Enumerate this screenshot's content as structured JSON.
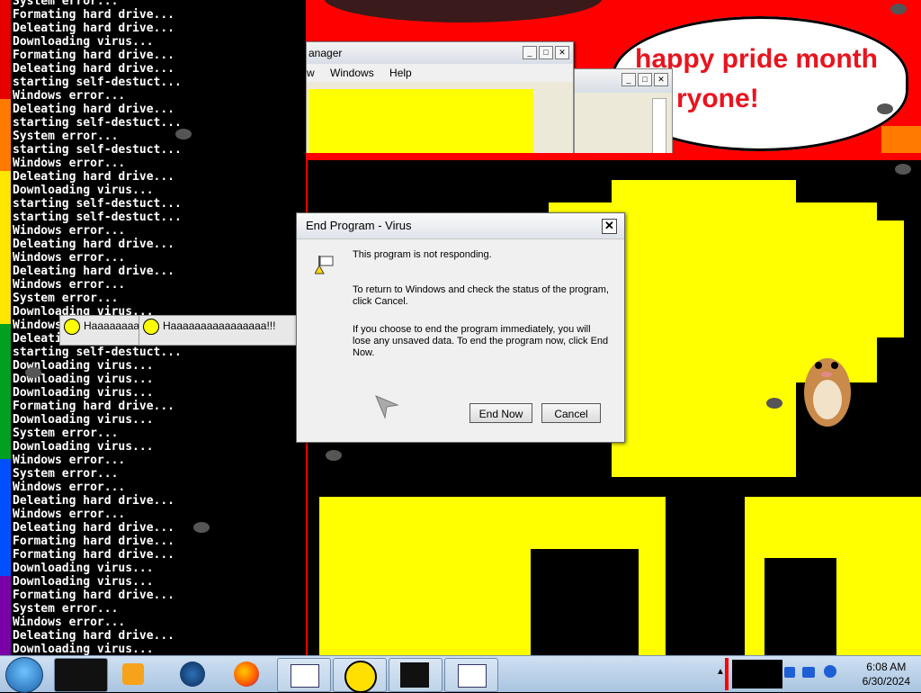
{
  "terminal": {
    "lines": [
      "System error...",
      "Formating hard drive...",
      "Deleating hard drive...",
      "Downloading virus...",
      "Formating hard drive...",
      "Deleating hard drive...",
      "starting self-destuct...",
      "Windows error...",
      "Deleating hard drive...",
      "starting self-destuct...",
      "System error...",
      "starting self-destuct...",
      "Windows error...",
      "Deleating hard drive...",
      "Downloading virus...",
      "starting self-destuct...",
      "starting self-destuct...",
      "Windows error...",
      "Deleating hard drive...",
      "Windows error...",
      "Deleating hard drive...",
      "Windows error...",
      "System error...",
      "Downloading virus...",
      "Windows error...",
      "Deleating hard drive...",
      "starting self-destuct...",
      "Downloading virus...",
      "Downloading virus...",
      "Downloading virus...",
      "Formating hard drive...",
      "Downloading virus...",
      "System error...",
      "Downloading virus...",
      "Windows error...",
      "System error...",
      "Windows error...",
      "Deleating hard drive...",
      "Windows error...",
      "Deleating hard drive...",
      "Formating hard drive...",
      "Formating hard drive...",
      "Downloading virus...",
      "Downloading virus...",
      "Formating hard drive...",
      "System error...",
      "Windows error...",
      "Deleating hard drive...",
      "Downloading virus..."
    ]
  },
  "task_manager": {
    "title": "anager",
    "menu": [
      "w",
      "Windows",
      "Help"
    ]
  },
  "bubble": {
    "line1": "happy pride month",
    "line2": "ryone!"
  },
  "haa_windows": [
    {
      "label": "Haaaaaaaaaa"
    },
    {
      "label": "Haaaaaaaaaaaaaaaa!!!"
    }
  ],
  "dialog": {
    "title": "End Program - Virus",
    "close": "✕",
    "line1": "This program is not responding.",
    "line2": "To return to Windows and check the status of the program, click Cancel.",
    "line3": "If you choose to end the program immediately, you will lose any unsaved data. To end the program now, click End Now.",
    "end_now": "End Now",
    "cancel": "Cancel"
  },
  "taskbar": {
    "time": "6:08 AM",
    "date": "6/30/2024",
    "items": [
      "terminal",
      "media-player",
      "globe",
      "firefox",
      "task-manager",
      "radiation",
      "monitor",
      "task-manager-2"
    ]
  },
  "colors": {
    "red": "#ff0000",
    "yellow": "#ffff00",
    "bubble_text": "#e8141e"
  }
}
